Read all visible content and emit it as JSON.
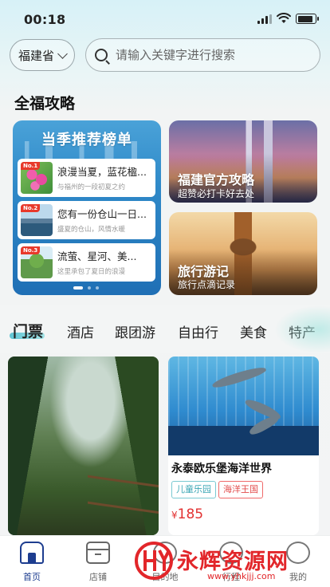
{
  "status_bar": {
    "time": "00:18",
    "battery_level": 0.9
  },
  "header": {
    "province": "福建省",
    "search_placeholder": "请输入关键字进行搜索"
  },
  "guide": {
    "section_title": "全福攻略",
    "ranking": {
      "title": "当季推荐榜单",
      "items": [
        {
          "badge": "No.1",
          "title": "浪漫当夏，蓝花楹...",
          "subtitle": "与福州的一段初夏之约"
        },
        {
          "badge": "No.2",
          "title": "您有一份仓山一日...",
          "subtitle": "盛夏的仓山，风情水暖"
        },
        {
          "badge": "No.3",
          "title": "流萤、星河、美...",
          "subtitle": "这里承包了夏日的浪漫"
        }
      ]
    },
    "official": {
      "title": "福建官方攻略",
      "subtitle": "超赞必打卡好去处"
    },
    "travel": {
      "title": "旅行游记",
      "subtitle": "旅行点滴记录"
    }
  },
  "category_tabs": [
    "门票",
    "酒店",
    "跟团游",
    "自由行",
    "美食",
    "特产"
  ],
  "products": [
    {
      "name": "永泰欧乐堡海洋世界",
      "tags": [
        "儿童乐园",
        "海洋王国"
      ],
      "price_symbol": "¥",
      "price": "185"
    }
  ],
  "bottom_nav": [
    "首页",
    "店铺",
    "目的地",
    "行程",
    "我的"
  ],
  "watermark": {
    "brand": "永辉资源网",
    "url": "www.yhkjjj.com"
  },
  "colors": {
    "accent": "#1d3d8f",
    "price": "#e23131",
    "brand_red": "#e2262a",
    "tab_underline": "#3bb7c9"
  }
}
